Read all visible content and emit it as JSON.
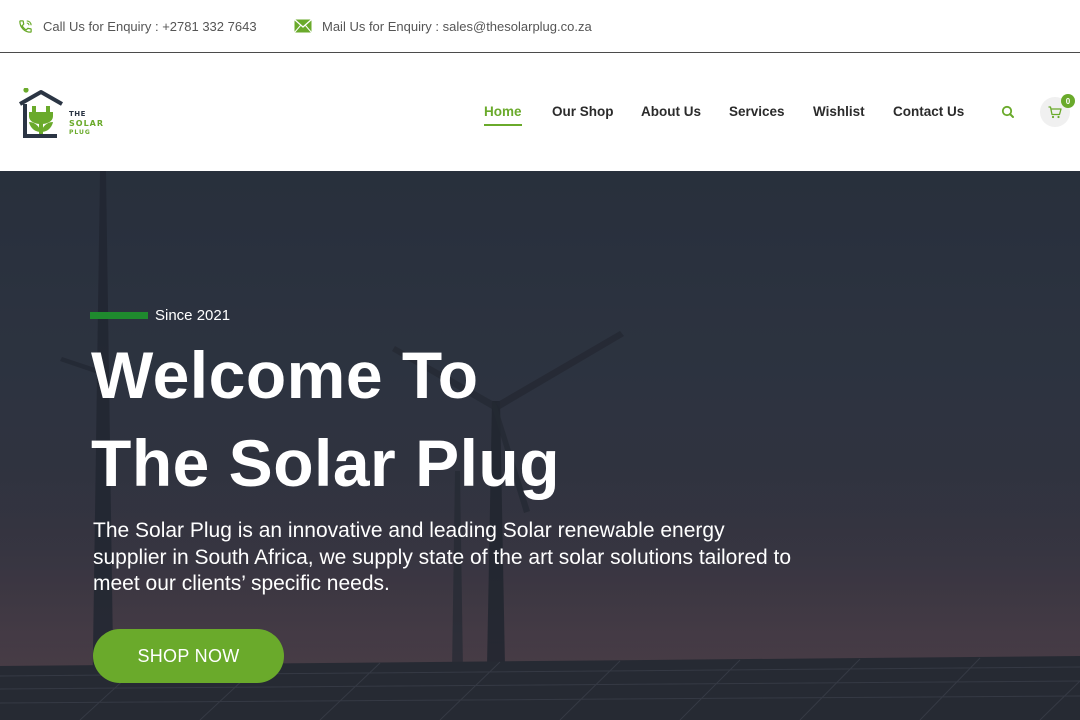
{
  "topbar": {
    "phone_text": "Call Us for Enquiry : +2781 332 7643",
    "mail_text": "Mail Us for Enquiry : sales@thesolarplug.co.za"
  },
  "logo": {
    "line1": "THE",
    "line2": "SOLAR",
    "line3": "PLUG"
  },
  "nav": {
    "items": [
      {
        "label": "Home"
      },
      {
        "label": "Our Shop"
      },
      {
        "label": "About Us"
      },
      {
        "label": "Services"
      },
      {
        "label": "Wishlist"
      },
      {
        "label": "Contact Us"
      }
    ],
    "cart_count": "0"
  },
  "hero": {
    "since": "Since 2021",
    "headline_line1": "Welcome To",
    "headline_line2": "The Solar Plug",
    "description": "The Solar Plug is an innovative and leading Solar renewable energy supplier in South Africa, we supply state of the art solar solutions tailored to meet our clients’ specific needs.",
    "button_label": "SHOP NOW"
  },
  "colors": {
    "accent": "#6aaa2b",
    "since_bar": "#1f8a2e",
    "nav_text": "#2b2b2b"
  }
}
